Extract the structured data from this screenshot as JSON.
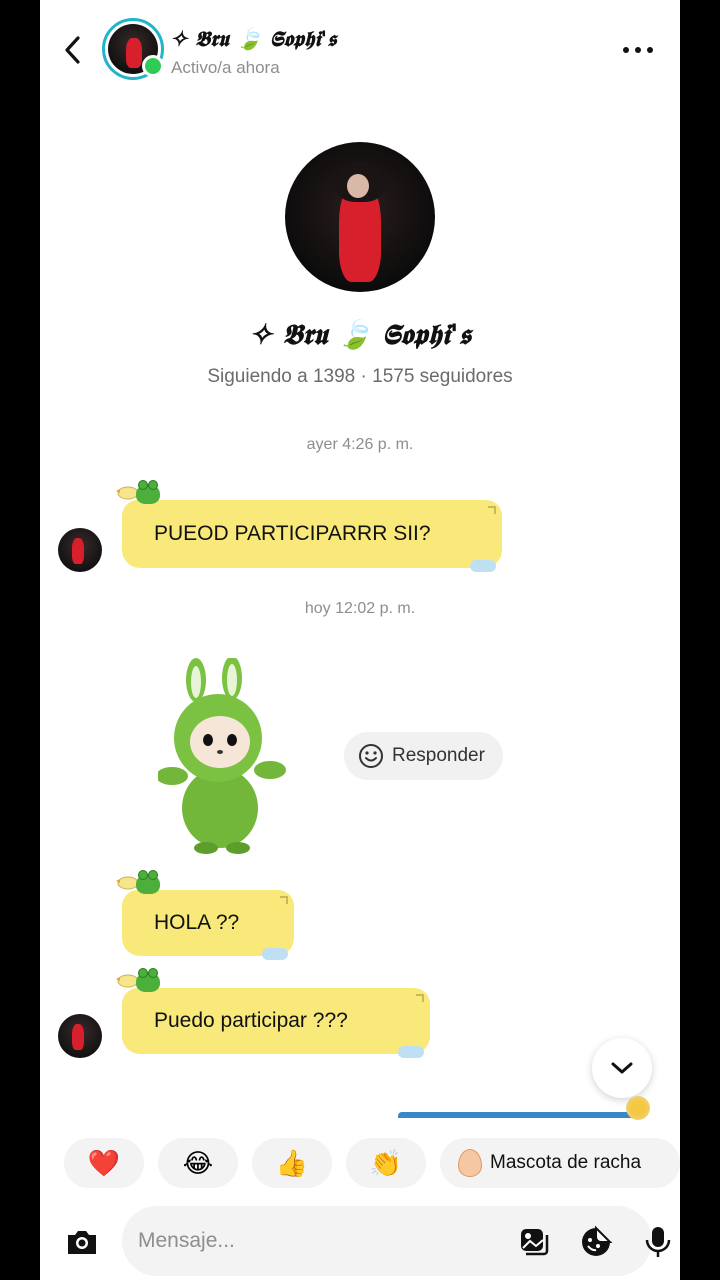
{
  "header": {
    "back_icon": "chevron-left-icon",
    "name": "✧ 𝕭𝖗𝖚 🍃 𝕾𝖔𝖕𝖍𝖎'𝖘",
    "status": "Activo/a ahora",
    "more_icon": "more-horizontal-icon",
    "online_color": "#2ecc55",
    "ring_color": "#22b4c8"
  },
  "profile": {
    "name": "✧ 𝕭𝖗𝖚 🍃 𝕾𝖔𝖕𝖍𝖎'𝖘",
    "stats": "Siguiendo a 1398 · 1575 seguidores"
  },
  "messages": {
    "ts1": "ayer 4:26 p. m.",
    "msg1": "PUEOD PARTICIPARRR SII?",
    "ts2": "hoy 12:02 p. m.",
    "reply_label": "Responder",
    "msg2": "HOLA ??",
    "msg3": "Puedo participar ???",
    "bubble_color": "#f9e97a"
  },
  "reactions": {
    "items": [
      "❤️",
      "😂",
      "👍",
      "👏"
    ],
    "pet_label": "Mascota de racha"
  },
  "composer": {
    "placeholder": "Mensaje...",
    "camera_icon": "camera-icon",
    "gallery_icon": "gallery-icon",
    "sticker_icon": "sticker-icon",
    "mic_icon": "microphone-icon"
  }
}
